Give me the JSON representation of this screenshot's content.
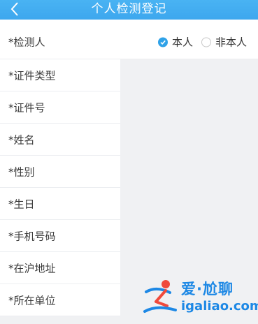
{
  "header": {
    "title": "个人检测登记",
    "back_icon": "chevron-left-icon"
  },
  "form": {
    "fields": [
      {
        "label": "*检测人"
      },
      {
        "label": "*证件类型"
      },
      {
        "label": "*证件号"
      },
      {
        "label": "*姓名"
      },
      {
        "label": "*性别"
      },
      {
        "label": "*生日"
      },
      {
        "label": "*手机号码"
      },
      {
        "label": "*在沪地址"
      },
      {
        "label": "*所在单位"
      }
    ],
    "tester_options": [
      {
        "label": "本人",
        "checked": true
      },
      {
        "label": "非本人",
        "checked": false
      }
    ]
  },
  "watermark": {
    "cn": "爱·尬聊",
    "en": "igaliao.com"
  },
  "colors": {
    "header": "#3da7ee",
    "accent": "#2fa2e8",
    "watermark": "#1d88e5"
  }
}
